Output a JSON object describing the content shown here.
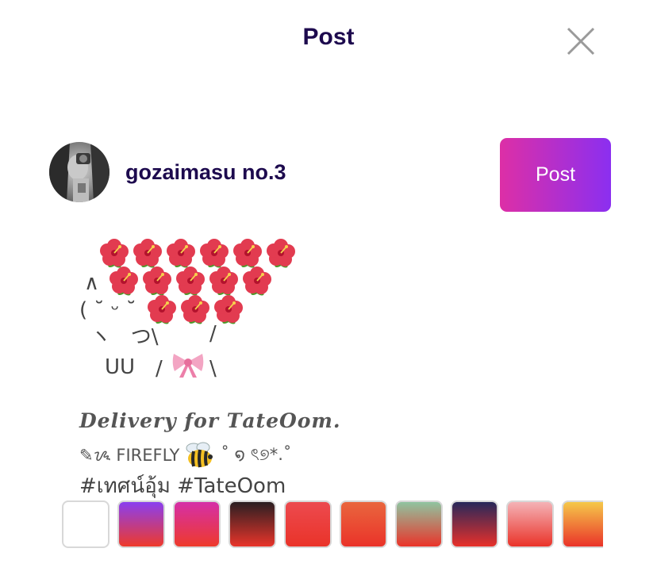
{
  "header": {
    "title": "Post",
    "close_icon": "close-icon"
  },
  "user": {
    "name": "gozaimasu no.3",
    "avatar_icon": "avatar"
  },
  "actions": {
    "post_label": "Post"
  },
  "post": {
    "art_lines": [
      "∧",
      "( ˘ ᵕ ˘",
      "ヽ   つ\\",
      "UU",
      "/",
      "/",
      "\\"
    ],
    "caption_title": "𝑫𝒆𝒍𝒊𝒗𝒆𝒓𝒚 𝒇𝒐𝒓 𝑻𝒂𝒕𝒆𝑶𝒐𝒎.",
    "caption_line2_prefix": "✎ᝰ FIREFLY",
    "caption_line2_suffix": "˚ ໑ ৎ୭*.˚",
    "hashtags": "#เทศน์อุ้ม #TateOom"
  },
  "background_swatches": [
    {
      "name": "white",
      "colors": [
        "#ffffff",
        "#ffffff"
      ]
    },
    {
      "name": "purple-red",
      "colors": [
        "#8a3ff0",
        "#ee3a2b"
      ]
    },
    {
      "name": "magenta-red",
      "colors": [
        "#d52fa8",
        "#ee3a2b"
      ]
    },
    {
      "name": "dark-red",
      "colors": [
        "#2a1f22",
        "#e8342a"
      ]
    },
    {
      "name": "red",
      "colors": [
        "#ec4a4f",
        "#ea3329"
      ]
    },
    {
      "name": "orange-red",
      "colors": [
        "#e9663e",
        "#ea3329"
      ]
    },
    {
      "name": "green-red",
      "colors": [
        "#8fc4a0",
        "#ea3329"
      ]
    },
    {
      "name": "navy-red",
      "colors": [
        "#27285a",
        "#e8302a"
      ]
    },
    {
      "name": "pink-red",
      "colors": [
        "#f4b2b6",
        "#ea3329"
      ]
    },
    {
      "name": "yellow-red",
      "colors": [
        "#f5c84a",
        "#ea3329"
      ]
    }
  ]
}
